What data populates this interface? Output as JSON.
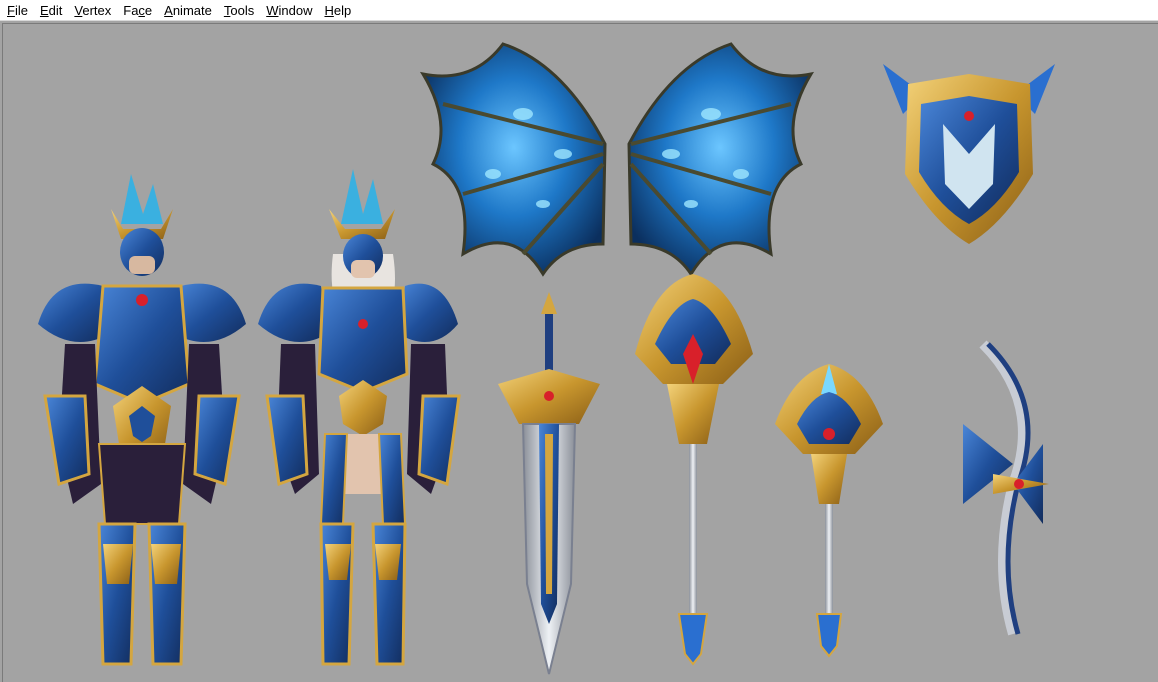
{
  "menu": {
    "items": [
      {
        "pre": "",
        "mnemonic": "F",
        "post": "ile"
      },
      {
        "pre": "",
        "mnemonic": "E",
        "post": "dit"
      },
      {
        "pre": "",
        "mnemonic": "V",
        "post": "ertex"
      },
      {
        "pre": "Fa",
        "mnemonic": "c",
        "post": "e"
      },
      {
        "pre": "",
        "mnemonic": "A",
        "post": "nimate"
      },
      {
        "pre": "",
        "mnemonic": "T",
        "post": "ools"
      },
      {
        "pre": "",
        "mnemonic": "W",
        "post": "indow"
      },
      {
        "pre": "",
        "mnemonic": "H",
        "post": "elp"
      }
    ]
  },
  "colors": {
    "viewport_bg": "#a3a3a3",
    "armor_blue": "#1f4f9a",
    "armor_dark": "#2a1f3a",
    "gold": "#d4a640",
    "wing_blue": "#1e78c8",
    "glow": "#7ad8ff",
    "gem_red": "#d8202a",
    "steel": "#c8ccd4"
  },
  "models": {
    "male_armor": "male-armor-model",
    "female_armor": "female-armor-model",
    "wings": "wings-model",
    "shield": "shield-model",
    "sword": "sword-model",
    "staff_large": "staff-model",
    "staff_small": "scepter-model",
    "bow": "bow-model"
  }
}
